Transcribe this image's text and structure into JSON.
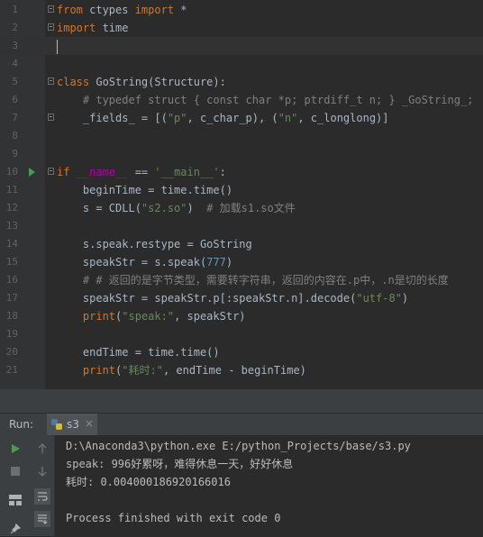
{
  "editor": {
    "lines": [
      {
        "no": "1",
        "segments": [
          [
            "kw",
            "from "
          ],
          [
            "",
            "ctypes "
          ],
          [
            "kw",
            "import "
          ],
          [
            "",
            "*"
          ]
        ]
      },
      {
        "no": "2",
        "segments": [
          [
            "kw",
            "import "
          ],
          [
            "",
            "time"
          ]
        ]
      },
      {
        "no": "3",
        "segments": []
      },
      {
        "no": "4",
        "segments": []
      },
      {
        "no": "5",
        "segments": [
          [
            "kw",
            "class "
          ],
          [
            "",
            "GoString(Structure):"
          ]
        ]
      },
      {
        "no": "6",
        "segments": [
          [
            "cmt",
            "    # typedef struct { const char *p; ptrdiff_t n; } _GoString_;"
          ]
        ]
      },
      {
        "no": "7",
        "segments": [
          [
            "",
            "    _fields_ = [("
          ],
          [
            "str",
            "\"p\""
          ],
          [
            "",
            ", c_char_p), ("
          ],
          [
            "str",
            "\"n\""
          ],
          [
            "",
            ", c_longlong)]"
          ]
        ]
      },
      {
        "no": "8",
        "segments": []
      },
      {
        "no": "9",
        "segments": []
      },
      {
        "no": "10",
        "segments": [
          [
            "kw",
            "if "
          ],
          [
            "dunder",
            "__name__"
          ],
          [
            "",
            " == "
          ],
          [
            "str",
            "'__main__'"
          ],
          [
            "",
            ":"
          ]
        ]
      },
      {
        "no": "11",
        "segments": [
          [
            "",
            "    beginTime = time.time()"
          ]
        ]
      },
      {
        "no": "12",
        "segments": [
          [
            "",
            "    s = CDLL("
          ],
          [
            "str",
            "\"s2.so\""
          ],
          [
            "",
            ")  "
          ],
          [
            "cmt",
            "# 加载s1.so文件"
          ]
        ]
      },
      {
        "no": "13",
        "segments": []
      },
      {
        "no": "14",
        "segments": [
          [
            "",
            "    s.speak.restype = GoString"
          ]
        ]
      },
      {
        "no": "15",
        "segments": [
          [
            "",
            "    speakStr = s.speak("
          ],
          [
            "num",
            "777"
          ],
          [
            "",
            ")"
          ]
        ]
      },
      {
        "no": "16",
        "segments": [
          [
            "cmt",
            "    # # 返回的是字节类型，需要转字符串，返回的内容在.p中，.n是切的长度"
          ]
        ]
      },
      {
        "no": "17",
        "segments": [
          [
            "",
            "    speakStr = speakStr.p[:speakStr.n].decode("
          ],
          [
            "str",
            "\"utf-8\""
          ],
          [
            "",
            ")"
          ]
        ]
      },
      {
        "no": "18",
        "segments": [
          [
            "kw",
            "    print"
          ],
          [
            "",
            "("
          ],
          [
            "str",
            "\"speak:\""
          ],
          [
            "",
            ", speakStr)"
          ]
        ]
      },
      {
        "no": "19",
        "segments": []
      },
      {
        "no": "20",
        "segments": [
          [
            "",
            "    endTime = time.time()"
          ]
        ]
      },
      {
        "no": "21",
        "segments": [
          [
            "kw",
            "    print"
          ],
          [
            "",
            "("
          ],
          [
            "str",
            "\"耗时:\""
          ],
          [
            "",
            ", endTime - beginTime)"
          ]
        ]
      }
    ]
  },
  "run_panel": {
    "label": "Run:",
    "tab_label": "s3",
    "tab_close": "×",
    "output": [
      "D:\\Anaconda3\\python.exe E:/python_Projects/base/s3.py",
      "speak: 996好累呀，难得休息一天，好好休息",
      "耗时: 0.004000186920166016",
      "",
      "Process finished with exit code 0"
    ]
  },
  "colors": {
    "background": "#2b2b2b",
    "keyword": "#cc7832",
    "string": "#6a8759",
    "number": "#6897bb",
    "comment": "#808080",
    "run_green": "#499c54"
  }
}
